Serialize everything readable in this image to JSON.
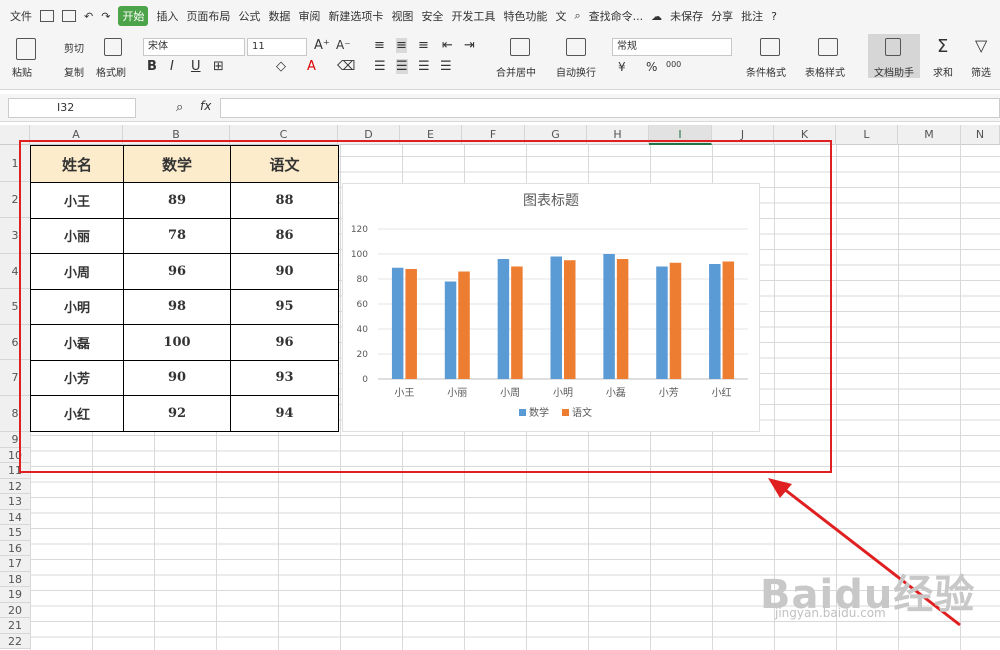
{
  "menubar": {
    "file": "文件",
    "tabs": [
      "开始",
      "插入",
      "页面布局",
      "公式",
      "数据",
      "审阅",
      "新建选项卡",
      "视图",
      "安全",
      "开发工具",
      "特色功能",
      "文"
    ],
    "search": "查找命令...",
    "unsaved": "未保存",
    "share": "分享",
    "comment": "批注",
    "help": "?"
  },
  "ribbon": {
    "paste": "粘贴",
    "cut": "剪切",
    "copy": "复制",
    "format_painter": "格式刷",
    "font_name": "宋体",
    "font_size": "11",
    "merge_center": "合并居中",
    "auto_wrap": "自动换行",
    "number_format": "常规",
    "currency_symbol": "¥",
    "percent_symbol": "%",
    "thousands": "000",
    "conditional_format": "条件格式",
    "table_style": "表格样式",
    "doc_assistant": "文档助手",
    "sum": "求和",
    "filter": "筛选"
  },
  "formula_bar": {
    "cell_ref": "I32",
    "fx": "fx",
    "value": ""
  },
  "columns": [
    "A",
    "B",
    "C",
    "D",
    "E",
    "F",
    "G",
    "H",
    "I",
    "J",
    "K",
    "L",
    "M",
    "N"
  ],
  "rows": [
    "1",
    "2",
    "3",
    "4",
    "5",
    "6",
    "7",
    "8",
    "9",
    "10",
    "11",
    "12",
    "13",
    "14",
    "15",
    "16",
    "17",
    "18",
    "19",
    "20",
    "21",
    "22"
  ],
  "table": {
    "headers": [
      "姓名",
      "数学",
      "语文"
    ],
    "rows": [
      [
        "小王",
        "89",
        "88"
      ],
      [
        "小丽",
        "78",
        "86"
      ],
      [
        "小周",
        "96",
        "90"
      ],
      [
        "小明",
        "98",
        "95"
      ],
      [
        "小磊",
        "100",
        "96"
      ],
      [
        "小芳",
        "90",
        "93"
      ],
      [
        "小红",
        "92",
        "94"
      ]
    ]
  },
  "chart_data": {
    "type": "bar",
    "title": "图表标题",
    "categories": [
      "小王",
      "小丽",
      "小周",
      "小明",
      "小磊",
      "小芳",
      "小红"
    ],
    "series": [
      {
        "name": "数学",
        "values": [
          89,
          78,
          96,
          98,
          100,
          90,
          92
        ],
        "color": "#5b9bd5"
      },
      {
        "name": "语文",
        "values": [
          88,
          86,
          90,
          95,
          96,
          93,
          94
        ],
        "color": "#ed7d31"
      }
    ],
    "yticks": [
      "0",
      "20",
      "40",
      "60",
      "80",
      "100",
      "120"
    ],
    "ylim": [
      0,
      120
    ],
    "grid": true,
    "legend": "bottom"
  },
  "watermark": {
    "logo": "Baidu经验",
    "url": "jingyan.baidu.com"
  }
}
